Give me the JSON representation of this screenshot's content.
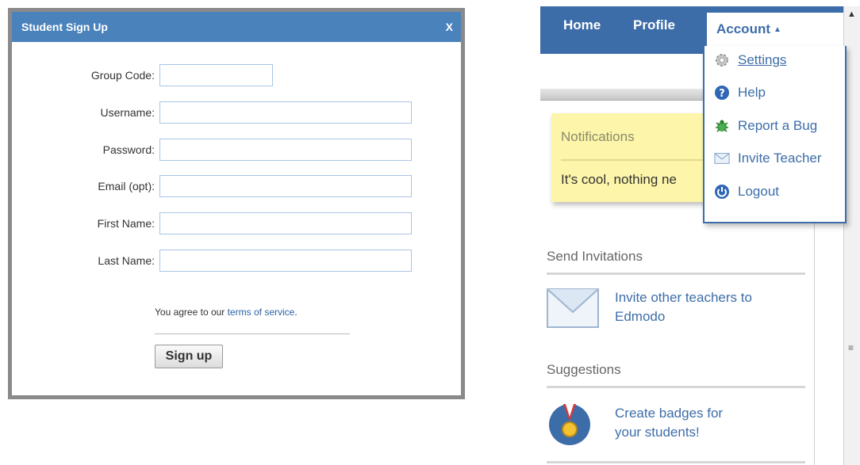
{
  "signup_dialog": {
    "title": "Student Sign Up",
    "close": "X",
    "fields": [
      {
        "label": "Group Code:",
        "value": ""
      },
      {
        "label": "Username:",
        "value": ""
      },
      {
        "label": "Password:",
        "value": ""
      },
      {
        "label": "Email (opt):",
        "value": ""
      },
      {
        "label": "First Name:",
        "value": ""
      },
      {
        "label": "Last Name:",
        "value": ""
      }
    ],
    "terms_prefix": "You agree to our ",
    "terms_link": "terms of service",
    "terms_suffix": ".",
    "button": "Sign up"
  },
  "edmodo": {
    "nav": {
      "home": "Home",
      "profile": "Profile",
      "account": "Account"
    },
    "menu": [
      {
        "label": "Settings",
        "icon": "gear-icon"
      },
      {
        "label": "Help",
        "icon": "help-icon"
      },
      {
        "label": "Report a Bug",
        "icon": "bug-icon"
      },
      {
        "label": "Invite Teacher",
        "icon": "envelope-icon"
      },
      {
        "label": "Logout",
        "icon": "power-icon"
      }
    ],
    "notifications": {
      "title": "Notifications",
      "message": "It's cool, nothing ne"
    },
    "send_invitations": {
      "title": "Send Invitations",
      "text_line1": "Invite other teachers to",
      "text_line2": "Edmodo"
    },
    "suggestions": {
      "title": "Suggestions",
      "text_line1": "Create badges for",
      "text_line2": "your students!"
    }
  },
  "colors": {
    "title_bar": "#4a82bb",
    "nav_bar": "#3d6da8",
    "link": "#2a62a8",
    "note": "#fdf5a9"
  }
}
